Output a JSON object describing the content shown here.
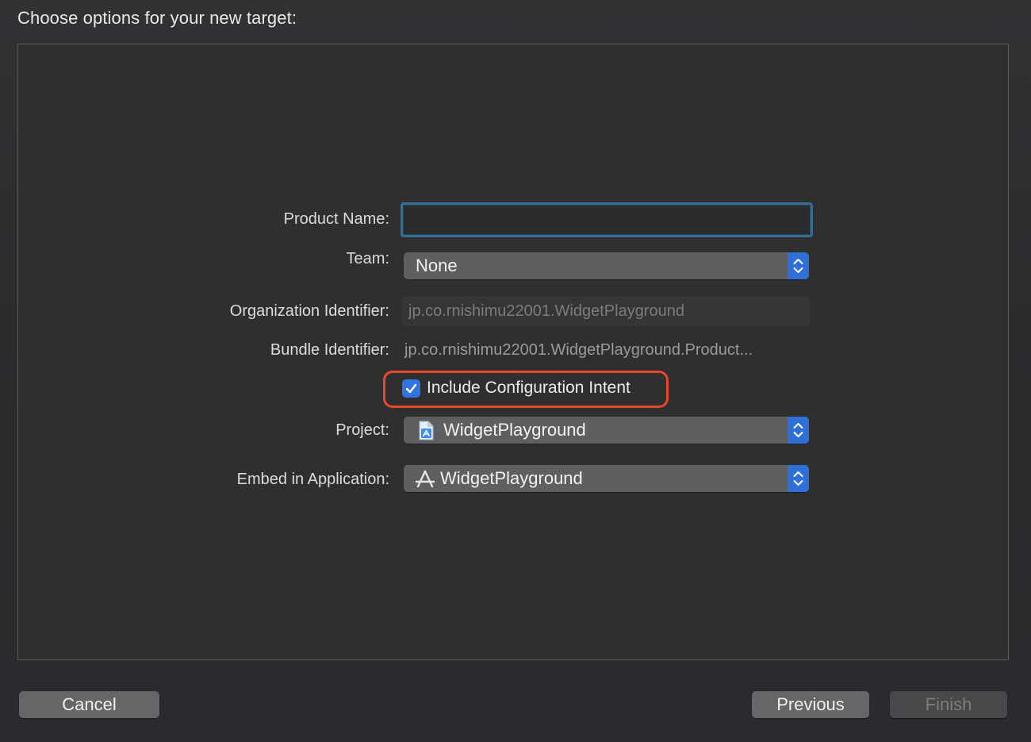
{
  "sheet": {
    "title": "Choose options for your new target:"
  },
  "form": {
    "product_name": {
      "label": "Product Name:",
      "value": ""
    },
    "team": {
      "label": "Team:",
      "value": "None"
    },
    "organization_identifier": {
      "label": "Organization Identifier:",
      "value": "jp.co.rnishimu22001.WidgetPlayground"
    },
    "bundle_identifier": {
      "label": "Bundle Identifier:",
      "value": "jp.co.rnishimu22001.WidgetPlayground.Product..."
    },
    "include_configuration_intent": {
      "label": "Include Configuration Intent",
      "checked": true
    },
    "project": {
      "label": "Project:",
      "value": "WidgetPlayground",
      "icon": "xcode-project-icon"
    },
    "embed_in_application": {
      "label": "Embed in Application:",
      "value": "WidgetPlayground",
      "icon": "app-target-icon"
    }
  },
  "buttons": {
    "cancel": "Cancel",
    "previous": "Previous",
    "finish": "Finish"
  },
  "colors": {
    "accent": "#2f74e0",
    "highlight_outline": "#e8472b",
    "focus_ring": "#3a6d93"
  }
}
